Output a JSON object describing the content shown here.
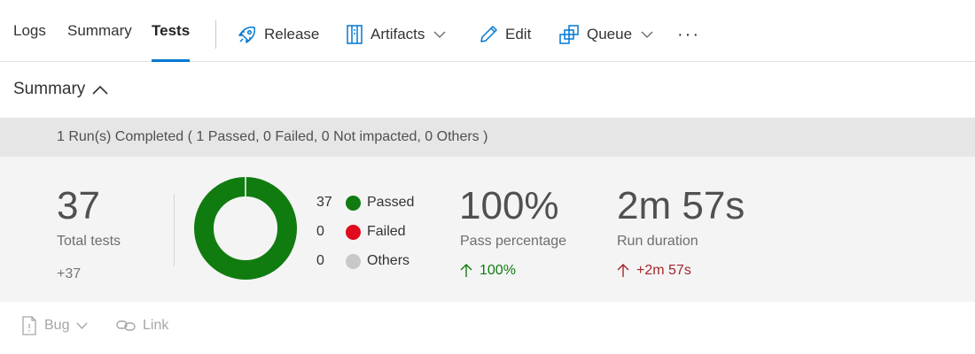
{
  "tabs": [
    {
      "label": "Logs",
      "active": false
    },
    {
      "label": "Summary",
      "active": false
    },
    {
      "label": "Tests",
      "active": true
    }
  ],
  "commands": {
    "release": {
      "label": "Release",
      "icon": "rocket-icon"
    },
    "artifacts": {
      "label": "Artifacts",
      "icon": "artifacts-icon"
    },
    "edit": {
      "label": "Edit",
      "icon": "pencil-icon"
    },
    "queue": {
      "label": "Queue",
      "icon": "queue-icon"
    },
    "more": {
      "label": "···",
      "icon": "more-icon"
    }
  },
  "summary": {
    "title": "Summary",
    "run_status": "1 Run(s) Completed ( 1 Passed, 0 Failed, 0 Not impacted, 0 Others )"
  },
  "stats": {
    "total_tests": {
      "value": "37",
      "label": "Total tests",
      "delta": "+37"
    },
    "legend": [
      {
        "count": "37",
        "label": "Passed",
        "color": "#107c10"
      },
      {
        "count": "0",
        "label": "Failed",
        "color": "#e00b1c"
      },
      {
        "count": "0",
        "label": "Others",
        "color": "#c8c8c8"
      }
    ],
    "pass_percentage": {
      "value": "100%",
      "label": "Pass percentage",
      "delta": "100%"
    },
    "run_duration": {
      "value": "2m 57s",
      "label": "Run duration",
      "delta": "+2m 57s"
    }
  },
  "chart_data": {
    "type": "pie",
    "categories": [
      "Passed",
      "Failed",
      "Others"
    ],
    "values": [
      37,
      0,
      0
    ],
    "colors": [
      "#107c10",
      "#e00b1c",
      "#c8c8c8"
    ]
  },
  "actions": {
    "bug": {
      "label": "Bug",
      "icon": "bug-icon"
    },
    "link": {
      "label": "Link",
      "icon": "link-icon"
    }
  },
  "colors": {
    "accent": "#0078d4",
    "passed": "#107c10",
    "negative": "#a4262c"
  }
}
